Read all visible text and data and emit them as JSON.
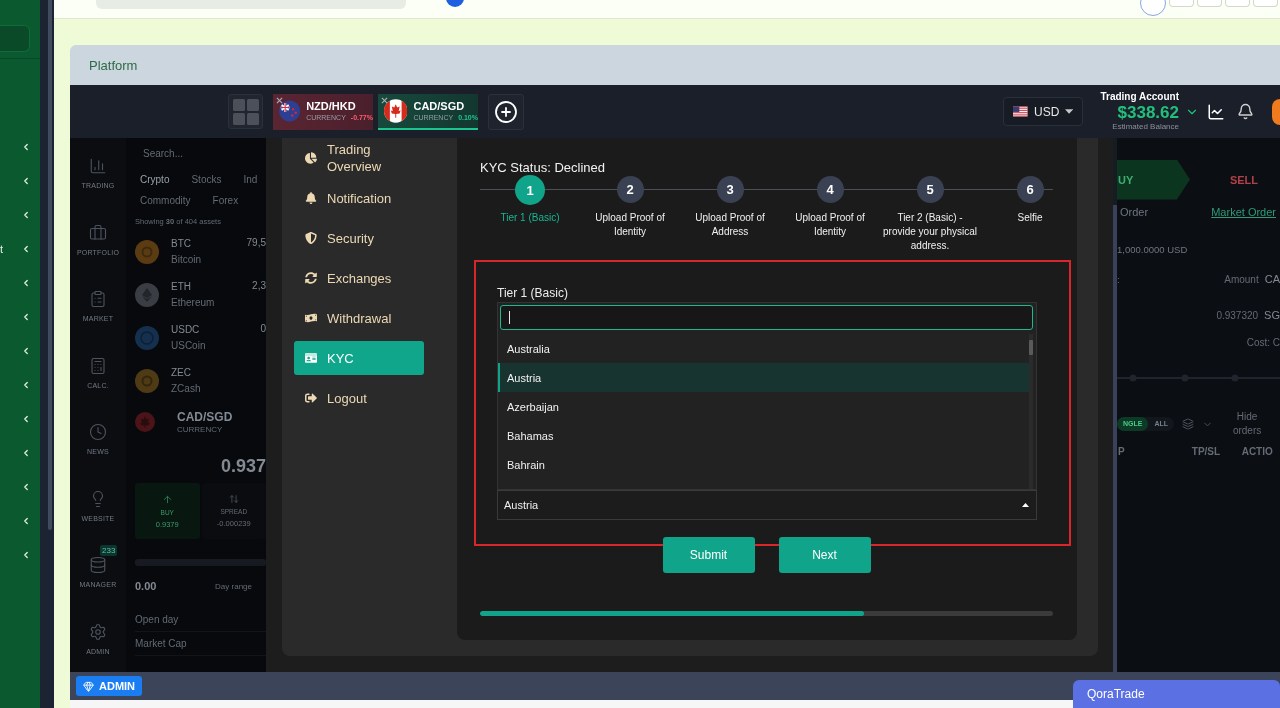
{
  "left_sidebar": {
    "items": [
      {
        "expanded": false
      },
      {
        "expanded": false
      },
      {
        "expanded": false
      },
      {
        "label": "t",
        "expanded": false
      },
      {
        "expanded": false
      },
      {
        "expanded": false
      },
      {
        "expanded": false
      },
      {
        "expanded": false
      },
      {
        "expanded": false
      },
      {
        "expanded": false
      },
      {
        "expanded": false
      },
      {
        "expanded": false
      },
      {
        "expanded": false
      }
    ]
  },
  "card": {
    "title": "Platform"
  },
  "toolbar": {
    "tabs": [
      {
        "symbol": "NZD/HKD",
        "type": "CURRENCY",
        "change": "-0.77%",
        "kind": "loss",
        "selected": false
      },
      {
        "symbol": "CAD/SGD",
        "type": "CURRENCY",
        "change": "0.10%",
        "kind": "gain",
        "selected": true
      }
    ],
    "currency": "USD",
    "account": {
      "title": "Trading Account",
      "balance": "$338.62",
      "caption": "Estimated Balance"
    }
  },
  "nav": {
    "items": [
      {
        "label": "TRADING"
      },
      {
        "label": "PORTFOLIO"
      },
      {
        "label": "MARKET"
      },
      {
        "label": "CALC."
      },
      {
        "label": "NEWS"
      },
      {
        "label": "WEBSITE"
      },
      {
        "label": "MANAGER",
        "badge": "233"
      },
      {
        "label": "ADMIN"
      }
    ]
  },
  "asset_panel": {
    "search": {
      "placeholder": "Search..."
    },
    "categories": [
      {
        "label": "Crypto",
        "selected": true
      },
      {
        "label": "Stocks",
        "selected": false
      },
      {
        "label": "Ind",
        "selected": false
      },
      {
        "label": "Commodity",
        "selected": false
      },
      {
        "label": "Forex",
        "selected": false
      }
    ],
    "summary": "Showing **30** of 404 assets",
    "assets": [
      {
        "symbol": "BTC",
        "name": "Bitcoin",
        "price": "79,5",
        "color": "#5b3c12"
      },
      {
        "symbol": "ETH",
        "name": "Ethereum",
        "price": "2,3",
        "color": "#3a3d43"
      },
      {
        "symbol": "USDC",
        "name": "USCoin",
        "price": "0",
        "color": "#15304f"
      },
      {
        "symbol": "ZEC",
        "name": "ZCash",
        "color": "#4e3a14"
      }
    ],
    "instrument": {
      "symbol": "CAD/SGD",
      "type": "CURRENCY",
      "price": "0.937"
    },
    "buy": {
      "label": "BUY",
      "value": "0.9379"
    },
    "spread": {
      "label": "SPREAD",
      "value": "-0.000239"
    },
    "day": {
      "value": "0.00",
      "label": "Day range"
    },
    "stats": [
      "Open day",
      "Market Cap"
    ]
  },
  "kyc": {
    "menu": [
      {
        "label": "Trading Overview",
        "selected": false
      },
      {
        "label": "Notification",
        "selected": false
      },
      {
        "label": "Security",
        "selected": false
      },
      {
        "label": "Exchanges",
        "selected": false
      },
      {
        "label": "Withdrawal",
        "selected": false
      },
      {
        "label": "KYC",
        "selected": true
      },
      {
        "label": "Logout",
        "selected": false
      }
    ],
    "status": "KYC Status: Declined",
    "steps": [
      {
        "number": "1",
        "label": "Tier 1 (Basic)",
        "selected": true
      },
      {
        "number": "2",
        "label": "Upload Proof of Identity",
        "selected": false
      },
      {
        "number": "3",
        "label": "Upload Proof of Address",
        "selected": false
      },
      {
        "number": "4",
        "label": "Upload Proof of Identity",
        "selected": false
      },
      {
        "number": "5",
        "label": "Tier 2 (Basic) - provide your physical address.",
        "selected": false
      },
      {
        "number": "6",
        "label": "Selfie",
        "selected": false
      }
    ],
    "form": {
      "label": "Tier 1 (Basic)",
      "dropdown": {
        "expanded": true,
        "options": [
          {
            "label": "Australia",
            "selected": false
          },
          {
            "label": "Austria",
            "selected": true
          },
          {
            "label": "Azerbaijan",
            "selected": false
          },
          {
            "label": "Bahamas",
            "selected": false
          },
          {
            "label": "Bahrain",
            "selected": false
          }
        ],
        "value": "Austria"
      }
    },
    "buttons": [
      "Submit",
      "Next"
    ],
    "progress": {
      "level": 0.67
    }
  },
  "order_panel": {
    "sides": [
      {
        "label": "UY",
        "selected": true
      },
      {
        "label": "SELL",
        "selected": false
      }
    ],
    "order_types": [
      {
        "label": "Order",
        "selected": false
      },
      {
        "label": "Market Order",
        "selected": true
      }
    ],
    "balance": "1,000.0000 USD",
    "amount": {
      "prefix": ":",
      "label": "Amount",
      "currency": "CA"
    },
    "price": {
      "value": "0.937320",
      "currency": "SG"
    },
    "cost": "Cost: C",
    "filters": [
      {
        "label": "NGLE",
        "selected": true
      },
      {
        "label": "ALL",
        "selected": false
      }
    ],
    "hide_orders": "Hide orders",
    "columns": [
      "P",
      "TP/SL",
      "ACTIO"
    ]
  },
  "bottom_bar": {
    "button": "ADMIN"
  },
  "chat_widget": {
    "label": "QoraTrade"
  }
}
